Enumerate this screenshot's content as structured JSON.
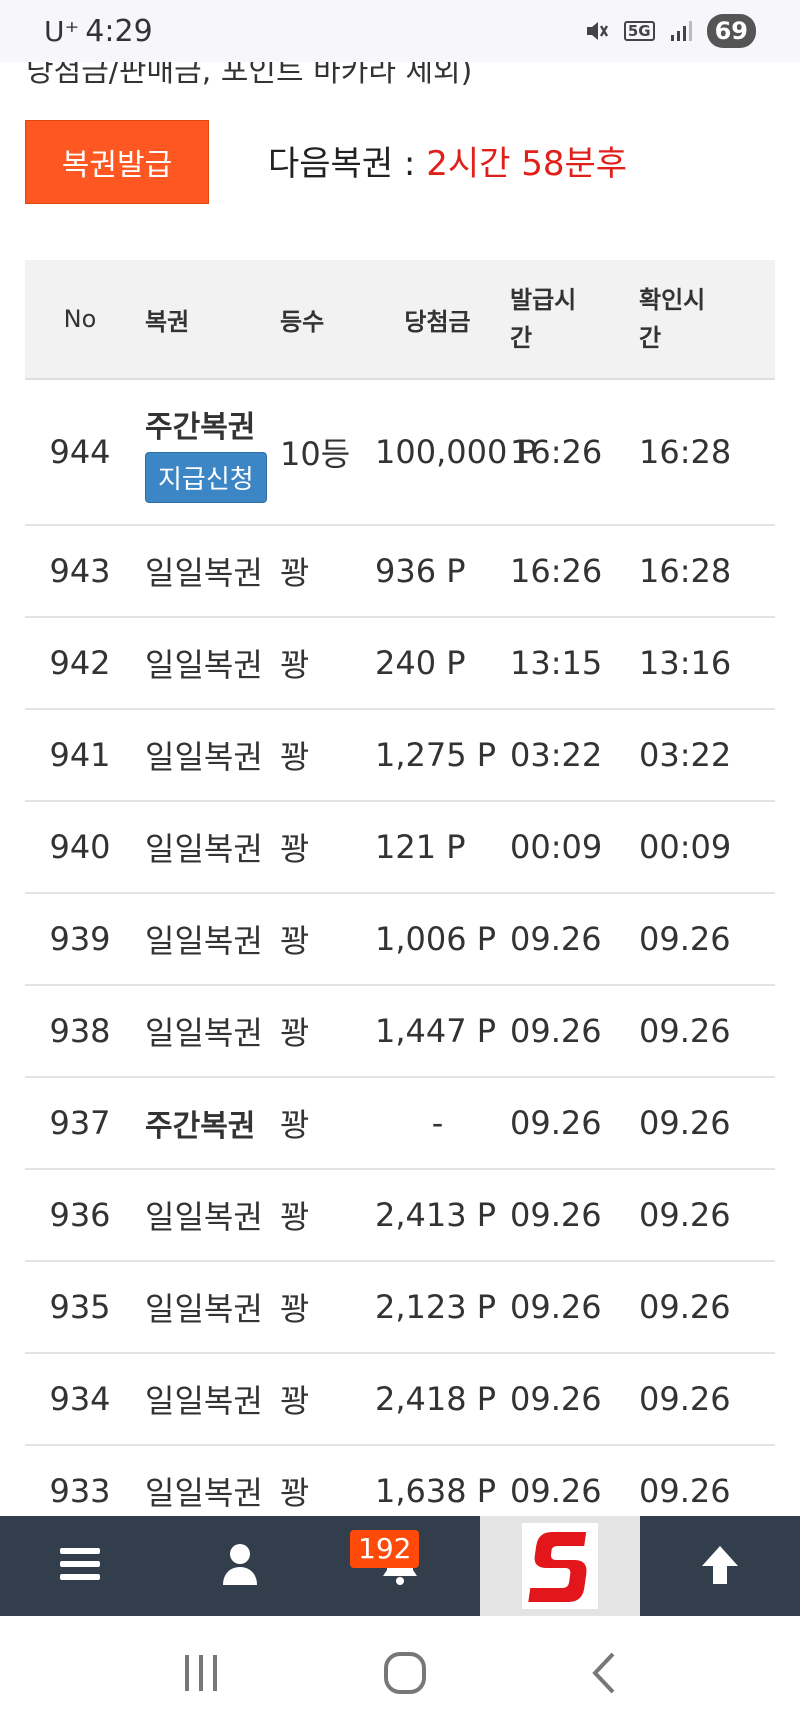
{
  "status_bar": {
    "carrier": "U⁺",
    "time": "4:29",
    "network": "5G",
    "battery": "69"
  },
  "notice_text": "당첨금/판매금, 포인트 바카라 제외)",
  "issue_button": "복권발급",
  "next_label": "다음복권 :",
  "next_value": "2시간 58분후",
  "table": {
    "headers": {
      "no": "No",
      "type": "복권",
      "rank": "등수",
      "prize": "당첨금",
      "issue_time": "발급시\n간",
      "check_time": "확인시\n간"
    },
    "rows": [
      {
        "no": "944",
        "type": "주간복권",
        "rank": "10등",
        "prize": "100,000 P",
        "issue_time": "16:26",
        "check_time": "16:28",
        "claim": "지급신청"
      },
      {
        "no": "943",
        "type": "일일복권",
        "rank": "꽝",
        "prize": "936 P",
        "issue_time": "16:26",
        "check_time": "16:28"
      },
      {
        "no": "942",
        "type": "일일복권",
        "rank": "꽝",
        "prize": "240 P",
        "issue_time": "13:15",
        "check_time": "13:16"
      },
      {
        "no": "941",
        "type": "일일복권",
        "rank": "꽝",
        "prize": "1,275 P",
        "issue_time": "03:22",
        "check_time": "03:22"
      },
      {
        "no": "940",
        "type": "일일복권",
        "rank": "꽝",
        "prize": "121 P",
        "issue_time": "00:09",
        "check_time": "00:09"
      },
      {
        "no": "939",
        "type": "일일복권",
        "rank": "꽝",
        "prize": "1,006 P",
        "issue_time": "09.26",
        "check_time": "09.26"
      },
      {
        "no": "938",
        "type": "일일복권",
        "rank": "꽝",
        "prize": "1,447 P",
        "issue_time": "09.26",
        "check_time": "09.26"
      },
      {
        "no": "937",
        "type": "주간복권",
        "rank": "꽝",
        "prize": "-",
        "issue_time": "09.26",
        "check_time": "09.26"
      },
      {
        "no": "936",
        "type": "일일복권",
        "rank": "꽝",
        "prize": "2,413 P",
        "issue_time": "09.26",
        "check_time": "09.26"
      },
      {
        "no": "935",
        "type": "일일복권",
        "rank": "꽝",
        "prize": "2,123 P",
        "issue_time": "09.26",
        "check_time": "09.26"
      },
      {
        "no": "934",
        "type": "일일복권",
        "rank": "꽝",
        "prize": "2,418 P",
        "issue_time": "09.26",
        "check_time": "09.26"
      },
      {
        "no": "933",
        "type": "일일복권",
        "rank": "꽝",
        "prize": "1,638 P",
        "issue_time": "09.26",
        "check_time": "09.26"
      }
    ]
  },
  "bottom_nav": {
    "items": [
      "menu-icon",
      "user-icon",
      "bell-icon",
      "site-logo",
      "arrow-up-icon"
    ],
    "notification_count": "192"
  },
  "colors": {
    "issue_button": "#ff5722",
    "next_value": "#e0211b",
    "claim_button": "#3d86c6",
    "bottom_nav": "#323e4b",
    "badge": "#ff4a0a"
  }
}
